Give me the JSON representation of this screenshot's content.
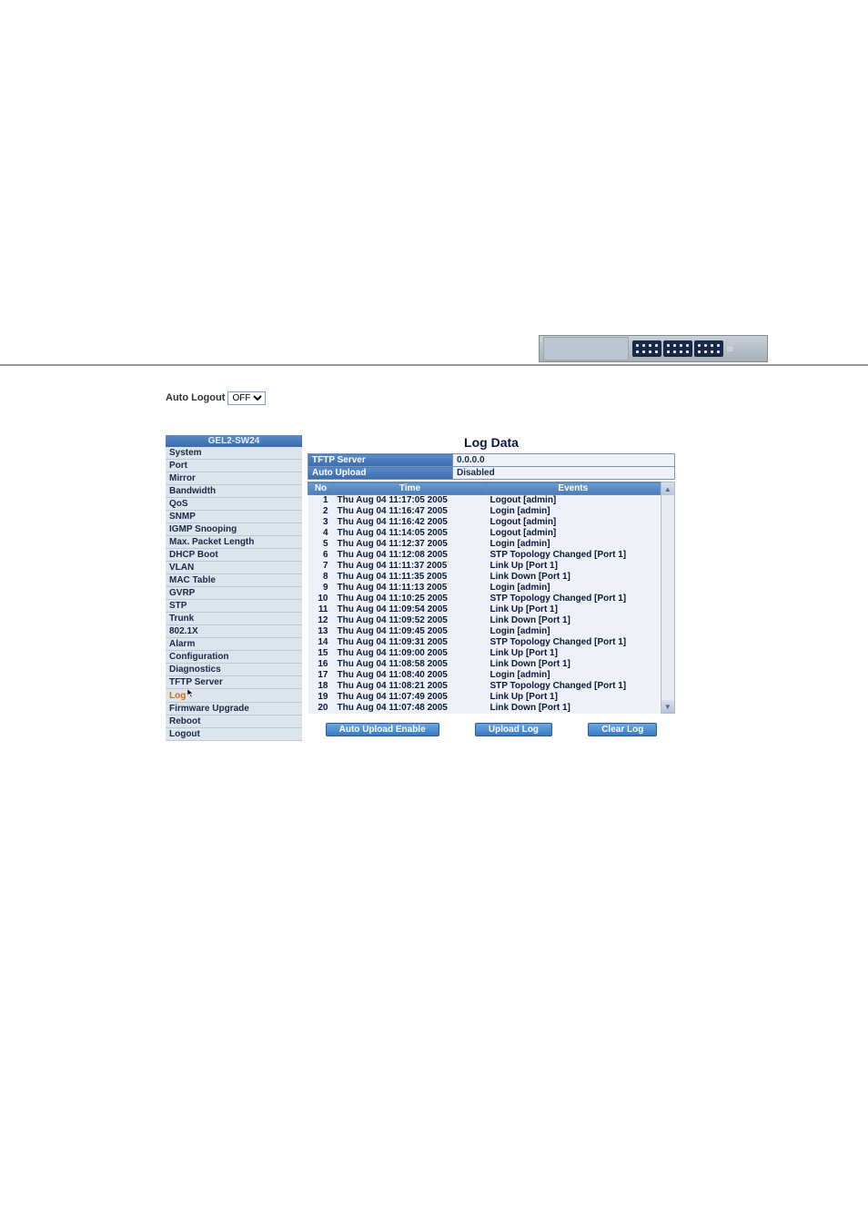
{
  "header": {
    "auto_logout_label": "Auto Logout",
    "auto_logout_value": "OFF"
  },
  "sidebar": {
    "title": "GEL2-SW24",
    "items": [
      {
        "label": "System"
      },
      {
        "label": "Port"
      },
      {
        "label": "Mirror"
      },
      {
        "label": "Bandwidth"
      },
      {
        "label": "QoS"
      },
      {
        "label": "SNMP"
      },
      {
        "label": "IGMP Snooping"
      },
      {
        "label": "Max. Packet Length"
      },
      {
        "label": "DHCP Boot"
      },
      {
        "label": "VLAN"
      },
      {
        "label": "MAC Table"
      },
      {
        "label": "GVRP"
      },
      {
        "label": "STP"
      },
      {
        "label": "Trunk"
      },
      {
        "label": "802.1X"
      },
      {
        "label": "Alarm"
      },
      {
        "label": "Configuration"
      },
      {
        "label": "Diagnostics"
      },
      {
        "label": "TFTP Server"
      },
      {
        "label": "Log",
        "selected": true
      },
      {
        "label": "Firmware Upgrade"
      },
      {
        "label": "Reboot"
      },
      {
        "label": "Logout"
      }
    ]
  },
  "page": {
    "title": "Log Data",
    "info": {
      "tftp_label": "TFTP Server",
      "tftp_value": "0.0.0.0",
      "auto_upload_label": "Auto Upload",
      "auto_upload_value": "Disabled"
    },
    "columns": {
      "no": "No",
      "time": "Time",
      "events": "Events"
    },
    "rows": [
      {
        "no": "1",
        "time": "Thu Aug 04 11:17:05 2005",
        "event": "Logout [admin]"
      },
      {
        "no": "2",
        "time": "Thu Aug 04 11:16:47 2005",
        "event": "Login [admin]"
      },
      {
        "no": "3",
        "time": "Thu Aug 04 11:16:42 2005",
        "event": "Logout [admin]"
      },
      {
        "no": "4",
        "time": "Thu Aug 04 11:14:05 2005",
        "event": "Logout [admin]"
      },
      {
        "no": "5",
        "time": "Thu Aug 04 11:12:37 2005",
        "event": "Login [admin]"
      },
      {
        "no": "6",
        "time": "Thu Aug 04 11:12:08 2005",
        "event": "STP Topology Changed [Port 1]"
      },
      {
        "no": "7",
        "time": "Thu Aug 04 11:11:37 2005",
        "event": "Link Up [Port 1]"
      },
      {
        "no": "8",
        "time": "Thu Aug 04 11:11:35 2005",
        "event": "Link Down [Port 1]"
      },
      {
        "no": "9",
        "time": "Thu Aug 04 11:11:13 2005",
        "event": "Login [admin]"
      },
      {
        "no": "10",
        "time": "Thu Aug 04 11:10:25 2005",
        "event": "STP Topology Changed [Port 1]"
      },
      {
        "no": "11",
        "time": "Thu Aug 04 11:09:54 2005",
        "event": "Link Up [Port 1]"
      },
      {
        "no": "12",
        "time": "Thu Aug 04 11:09:52 2005",
        "event": "Link Down [Port 1]"
      },
      {
        "no": "13",
        "time": "Thu Aug 04 11:09:45 2005",
        "event": "Login [admin]"
      },
      {
        "no": "14",
        "time": "Thu Aug 04 11:09:31 2005",
        "event": "STP Topology Changed [Port 1]"
      },
      {
        "no": "15",
        "time": "Thu Aug 04 11:09:00 2005",
        "event": "Link Up [Port 1]"
      },
      {
        "no": "16",
        "time": "Thu Aug 04 11:08:58 2005",
        "event": "Link Down [Port 1]"
      },
      {
        "no": "17",
        "time": "Thu Aug 04 11:08:40 2005",
        "event": "Login [admin]"
      },
      {
        "no": "18",
        "time": "Thu Aug 04 11:08:21 2005",
        "event": "STP Topology Changed [Port 1]"
      },
      {
        "no": "19",
        "time": "Thu Aug 04 11:07:49 2005",
        "event": "Link Up [Port 1]"
      },
      {
        "no": "20",
        "time": "Thu Aug 04 11:07:48 2005",
        "event": "Link Down [Port 1]"
      }
    ],
    "buttons": {
      "auto_upload_enable": "Auto Upload Enable",
      "upload_log": "Upload Log",
      "clear_log": "Clear Log"
    }
  }
}
